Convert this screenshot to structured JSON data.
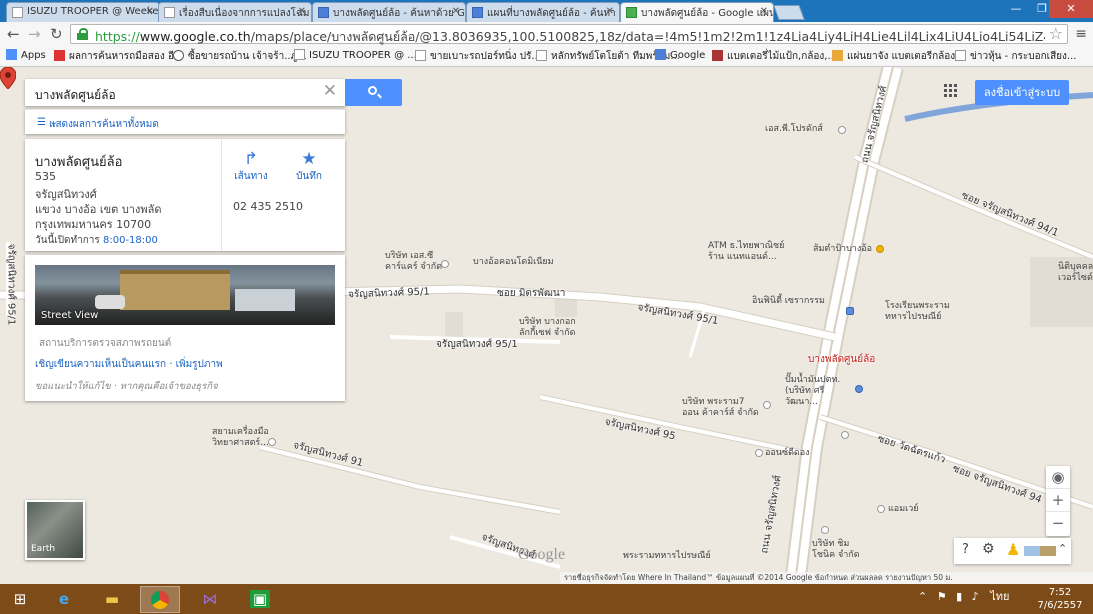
{
  "browser": {
    "tabs": [
      {
        "title": "ISUZU TROOPER @ Weeke",
        "icon": "page"
      },
      {
        "title": "เรื่องสืบเนื่องจากการแปลงโฉม",
        "icon": "page"
      },
      {
        "title": "บางพลัดศูนย์ล้อ - ค้นหาด้วย G",
        "icon": "google"
      },
      {
        "title": "แผนที่บางพลัดศูนย์ล้อ - ค้นหา",
        "icon": "google"
      },
      {
        "title": "บางพลัดศูนย์ล้อ - Google แผน",
        "icon": "maps",
        "active": true
      }
    ],
    "url_prefix": "https://",
    "url_domain": "www.google.co.th",
    "url_path": "/maps/place/บางพลัดศูนย์ล้อ/@13.8036935,100.5100825,18z/data=!4m5!1m2!2m1!1z4Lia4Liy4LiH4Lie4Lil4Lix4LiU4Lio4Li54LiZ4Lii4LmM4Lil4Lm",
    "bookmarks": [
      "Apps",
      "ผลการค้นหารถมือสอง อี...",
      "ซื้อขายรถบ้าน เจ้าจร้า..ภู...",
      "ISUZU TROOPER @ ...",
      "ขายเบาะรถปอร์ทนิ่ง ปรั...",
      "หลักทรัพย์โตโยต้า ทีมพร้อม...",
      "Google",
      "แบตเตอรี่ไม้แป้ก,กล้อง,...",
      "แผ่นยาจัง แบตเตอรีกล้อง...",
      "ข่าวหุ้น - กระบอกเสียง..."
    ]
  },
  "search": {
    "query": "บางพลัดศูนย์ล้อ",
    "show_all": "แสดงผลการค้นหาทั้งหมด"
  },
  "place": {
    "name": "บางพลัดศูนย์ล้อ",
    "address_lines": [
      "535",
      "จรัญสนิทวงศ์",
      "แขวง บางอ้อ เขต บางพลัด",
      "กรุงเทพมหานคร 10700"
    ],
    "hours_label": "วันนี้เปิดทำการ",
    "hours": "8:00-18:00",
    "directions_label": "เส้นทาง",
    "save_label": "บันทึก",
    "phone": "02 435 2510",
    "street_view_label": "Street View",
    "category": "สถานบริการตรวจสภาพรถยนต์",
    "review_link": "เชิญเขียนความเห็นเป็นคนแรก",
    "add_photo_link": "เพิ่มรูปภาพ",
    "owner_note": "ขอแนะนำให้แก้ไข · หากคุณคือเจ้าของธุรกิจ"
  },
  "map": {
    "signin": "ลงชื่อเข้าสู่ระบบ",
    "earth_label": "Earth",
    "watermark": "Google",
    "attribution": "รายชื่อธุรกิจจัดทำโดย Where In Thailand™   ข้อมูลแผนที่ ©2014 Google   ข้อกำหนด   ส่วนผลลด   รายงานปัญหา   50 ม.",
    "marker_label": "บางพลัดศูนย์ล้อ",
    "road_labels": [
      "ถนน จรัญสนิทวงศ์",
      "ถนน จรัญสนิทวงศ์",
      "จรัญสนิทวงศ์ 95/1",
      "ซอย มิตรพัฒนา",
      "จรัญสนิทวงศ์ 95/1",
      "จรัญสนิทวงศ์ 95/1",
      "จรัญสนิทวงศ์ 95",
      "จรัญสนิทวงศ์ 91",
      "ซอย จรัญสนิทวงศ์ 94/1",
      "ซอย วัดฉัตรแก้ว",
      "ซอย จรัญสนิทวงศ์ 94",
      "จรัญสนิทวงศ์",
      "จรัญสนิทวงศ์ 95/1"
    ],
    "poi_labels": [
      "เอส.พี.โปรดักส์",
      "บริษัท เอส.ซี คาร์แคร์ จำกัด",
      "บางอ้อคอนโดมิเนียม",
      "ATM ธ.ไทยพาณิชย์ ร้าน แนทแอนด์...",
      "ส้มตำป้าบางอ้อ",
      "นิติบุคคล เวอร์ไซด์",
      "อินฟินิตี้ เซรากรรม",
      "โรงเรียนพระราม ทหารไปรษณีย์",
      "บริษัท บางกอก ลักกี้เซฟ จำกัด",
      "ปั๊มน้ำมันปตท. (บริษัท ศรีวัฒนา...",
      "บริษัท พระราม7 ออน ค้าคาร์ส์ จำกัด",
      "สยามเครื่องมือ วิทยาศาสตร์...",
      "ออนซ์ดีดอง",
      "แอมเวย์",
      "บริษัท ชิม โชนิค จำกัด",
      "พระรามทหารไปรษณีย์"
    ]
  },
  "taskbar": {
    "lang": "ไทย",
    "time": "7:52",
    "date": "7/6/2557"
  },
  "colors": {
    "tabstrip": "#1d74bb",
    "accent_blue": "#4d90fe",
    "link": "#1a62c4",
    "map_bg": "#ede9e1",
    "marker": "#db4437",
    "taskbar": "#7d4b17"
  }
}
